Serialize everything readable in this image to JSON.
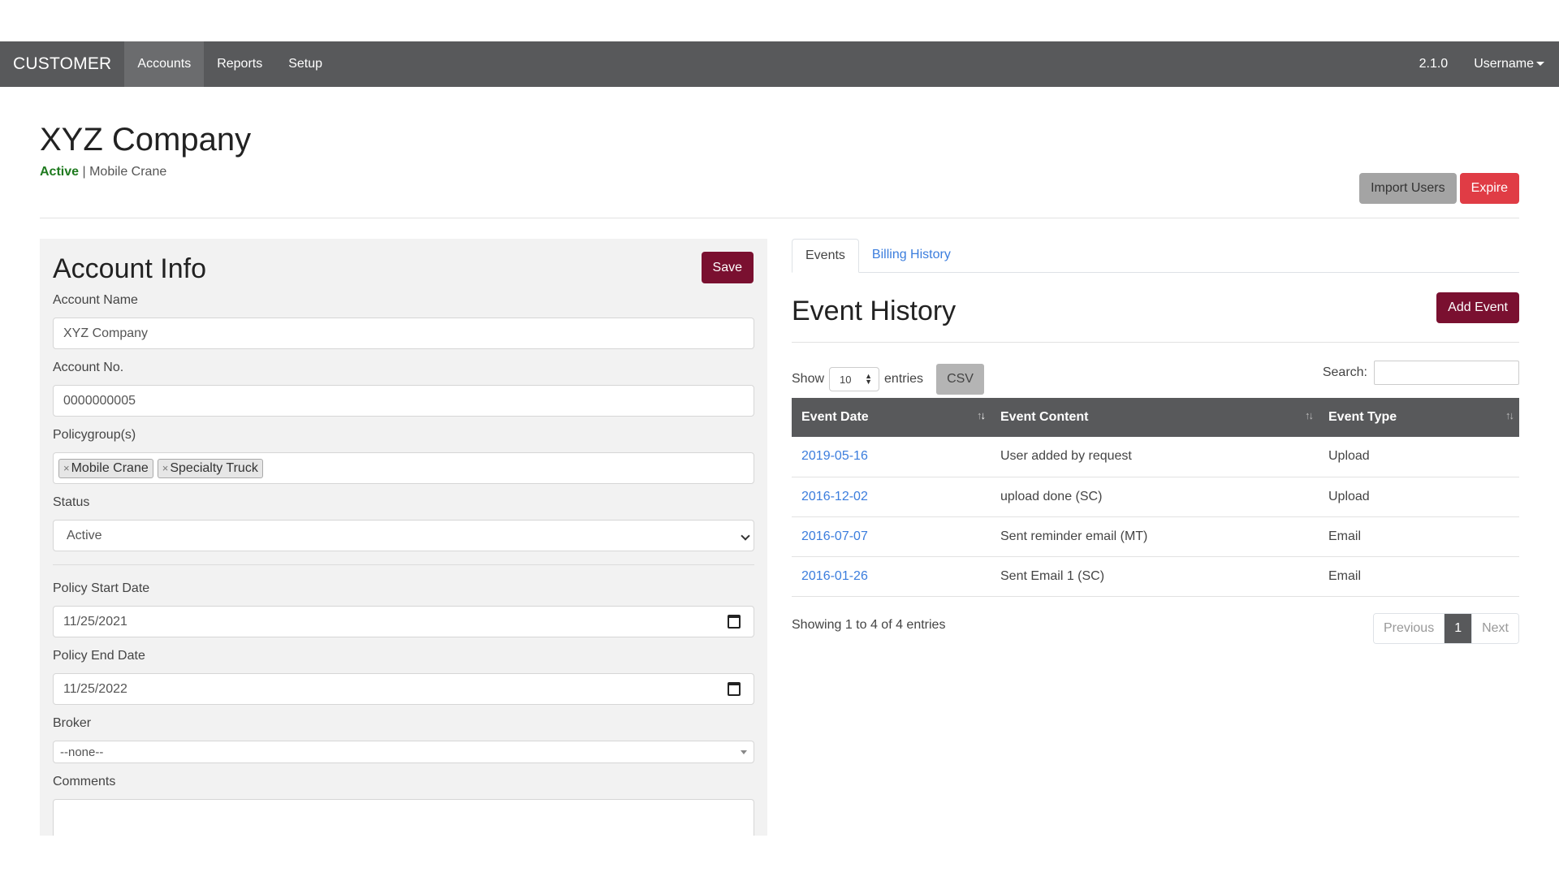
{
  "nav": {
    "brand": "CUSTOMER",
    "items": [
      {
        "label": "Accounts",
        "active": true
      },
      {
        "label": "Reports",
        "active": false
      },
      {
        "label": "Setup",
        "active": false
      }
    ],
    "version": "2.1.0",
    "username": "Username"
  },
  "header": {
    "company": "XYZ Company",
    "status": "Active",
    "separator": "|",
    "policy": "Mobile Crane",
    "import_label": "Import Users",
    "expire_label": "Expire"
  },
  "account": {
    "title": "Account Info",
    "save_label": "Save",
    "name_label": "Account Name",
    "name_value": "XYZ Company",
    "no_label": "Account No.",
    "no_value": "0000000005",
    "policygroups_label": "Policygroup(s)",
    "policygroups": [
      "Mobile Crane",
      "Specialty Truck"
    ],
    "tag_remove": "×",
    "status_label": "Status",
    "status_value": "Active",
    "start_label": "Policy Start Date",
    "start_value": "11/25/2021",
    "end_label": "Policy End Date",
    "end_value": "11/25/2022",
    "broker_label": "Broker",
    "broker_value": "--none--",
    "comments_label": "Comments"
  },
  "events": {
    "tabs": [
      {
        "label": "Events",
        "active": true
      },
      {
        "label": "Billing History",
        "active": false
      }
    ],
    "title": "Event History",
    "add_label": "Add Event",
    "show_label": "Show",
    "entries_value": "10",
    "entries_label": "entries",
    "csv_label": "CSV",
    "search_label": "Search:",
    "columns": [
      "Event Date",
      "Event Content",
      "Event Type"
    ],
    "rows": [
      {
        "date": "2019-05-16",
        "content": "User added by request",
        "type": "Upload"
      },
      {
        "date": "2016-12-02",
        "content": "upload done (SC)",
        "type": "Upload"
      },
      {
        "date": "2016-07-07",
        "content": "Sent reminder email (MT)",
        "type": "Email"
      },
      {
        "date": "2016-01-26",
        "content": "Sent Email 1 (SC)",
        "type": "Email"
      }
    ],
    "info": "Showing 1 to 4 of 4 entries",
    "prev_label": "Previous",
    "page": "1",
    "next_label": "Next"
  },
  "colors": {
    "navbar": "#58595b",
    "accent": "#7a1030",
    "danger": "#e03c45",
    "active_status": "#1e7a1e",
    "link": "#3b7ddd"
  }
}
